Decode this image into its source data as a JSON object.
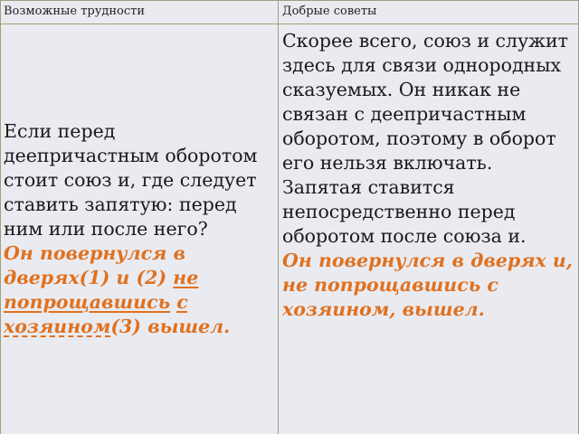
{
  "headers": {
    "left": "Возможные трудности",
    "right": "Добрые советы"
  },
  "left_cell": {
    "question": "Если перед деепричастным оборотом стоит союз и, где следует ставить запятую: перед ним или после него?",
    "example": {
      "part1": "Он повернулся в дверях(1) и (2) ",
      "underlined_word": "не попрощавшись",
      "space": " ",
      "dashed_1": "с",
      "line_break_space": " ",
      "dashed_2": "хозяином",
      "part2": "(3) вышел."
    }
  },
  "right_cell": {
    "advice": "Скорее всего, союз и служит здесь для связи однородных сказуемых. Он никак не связан с деепричастным оборотом, поэтому в оборот его нельзя включать. Запятая ставится непосредственно перед оборотом после союза и.",
    "example": "Он повернулся в дверях  и, не попрощавшись с хозяином, вышел."
  }
}
